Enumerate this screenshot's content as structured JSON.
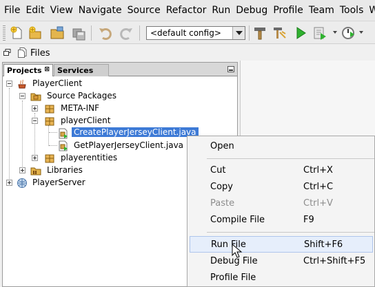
{
  "menubar": {
    "items": [
      "File",
      "Edit",
      "View",
      "Navigate",
      "Source",
      "Refactor",
      "Run",
      "Debug",
      "Profile",
      "Team",
      "Tools",
      "Wi"
    ]
  },
  "toolbar": {
    "config_value": "<default config>",
    "icons": [
      "new-file-icon",
      "new-project-icon",
      "open-project-icon",
      "save-all-icon",
      "undo-icon",
      "redo-icon",
      "build-hammer-icon",
      "clean-build-icon",
      "run-icon",
      "debug-icon",
      "profile-icon"
    ]
  },
  "files_window": {
    "label": "Files"
  },
  "panel": {
    "tabs": [
      {
        "label": "Projects",
        "close": "⊠"
      },
      {
        "label": "Services"
      }
    ]
  },
  "tree": {
    "player_client": "PlayerClient",
    "source_packages": "Source Packages",
    "meta_inf": "META-INF",
    "player_client_pkg": "playerClient",
    "create_file": "CreatePlayerJerseyClient.java",
    "get_file": "GetPlayerJerseyClient.java",
    "playerentities": "playerentities",
    "libraries": "Libraries",
    "player_server": "PlayerServer"
  },
  "context_menu": {
    "open": {
      "label": "Open"
    },
    "cut": {
      "label": "Cut",
      "shortcut": "Ctrl+X"
    },
    "copy": {
      "label": "Copy",
      "shortcut": "Ctrl+C"
    },
    "paste": {
      "label": "Paste",
      "shortcut": "Ctrl+V"
    },
    "compile": {
      "label": "Compile File",
      "shortcut": "F9"
    },
    "run": {
      "label": "Run File",
      "shortcut": "Shift+F6"
    },
    "debug": {
      "label": "Debug File",
      "shortcut": "Ctrl+Shift+F5"
    },
    "profile": {
      "label": "Profile File"
    }
  },
  "colors": {
    "selection": "#3d7ad6",
    "hover_highlight": "#e6eefb",
    "disabled_text": "#8d8d8d"
  }
}
